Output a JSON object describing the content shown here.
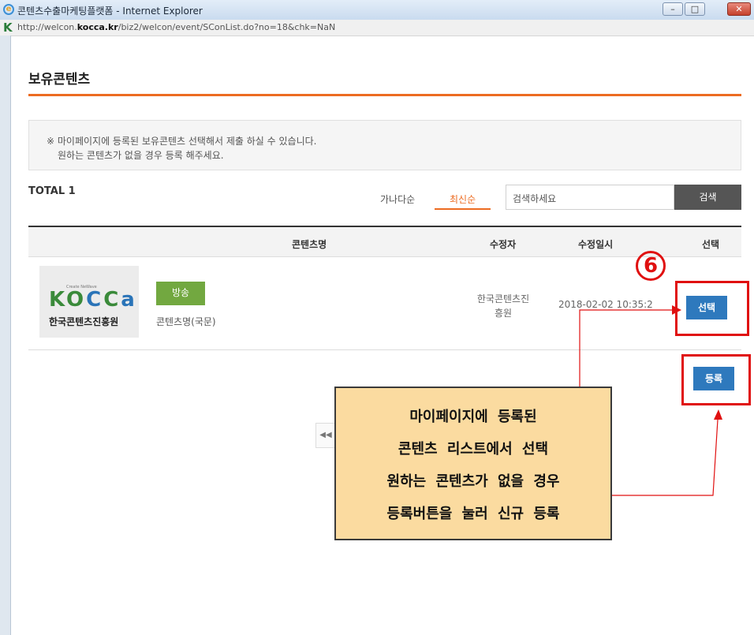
{
  "window": {
    "title": "콘텐츠수출마케팅플랫폼 - Internet Explorer",
    "url_prefix": "http://welcon.",
    "url_domain": "kocca.kr",
    "url_suffix": "/biz2/welcon/event/SConList.do?no=18&chk=NaN",
    "minimize_label": "–",
    "maximize_label": "□",
    "close_label": "✕"
  },
  "page": {
    "title": "보유콘텐츠",
    "notice_line1": "※ 마이페이지에 등록된 보유콘텐츠 선택해서 제출 하실 수 있습니다.",
    "notice_line2": "원하는 콘텐츠가 없을 경우 등록 해주세요."
  },
  "toolbar": {
    "total": "TOTAL 1",
    "sort_alpha": "가나다순",
    "sort_latest": "최신순",
    "search_placeholder": "검색하세요",
    "search_button": "검색"
  },
  "table": {
    "headers": [
      "콘텐츠명",
      "수정자",
      "수정일시",
      "선택"
    ],
    "rows": [
      {
        "thumb_logo": "kocca",
        "thumb_tag": "Create NeWave",
        "thumb_name": "한국콘텐츠진흥원",
        "category": "방송",
        "name": "콘텐츠명(국문)",
        "editor_line1": "한국콘텐츠진",
        "editor_line2": "흥원",
        "date": "2018-02-02 10:35:2",
        "select_button": "선택"
      }
    ]
  },
  "register_button": "등록",
  "pager_prev": "◀◀",
  "annotation": {
    "step_number": "6",
    "callout_lines": [
      "마이페이지에 등록된",
      "콘텐츠 리스트에서 선택",
      "원하는 콘텐츠가 없을 경우",
      "등록버튼을 눌러 신규 등록"
    ],
    "highlight_color": "#e01010",
    "callout_bg": "#fbdba0"
  },
  "colors": {
    "accent": "#ec6b21",
    "button_blue": "#2e79bd",
    "badge_green": "#72a840",
    "search_button_bg": "#555555"
  }
}
